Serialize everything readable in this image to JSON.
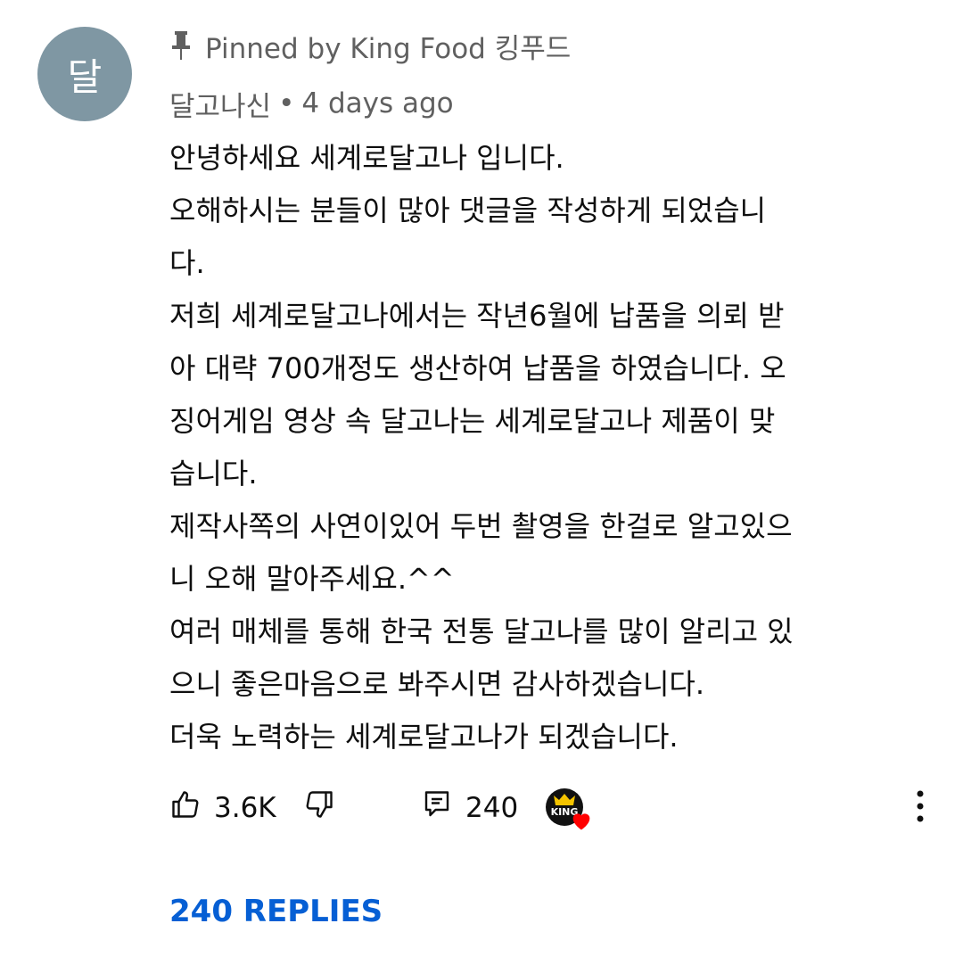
{
  "comment": {
    "avatar_letter": "달",
    "avatar_color": "#7f97a3",
    "pinned_text": "Pinned by King Food 킹푸드",
    "author": "달고나신",
    "separator": "•",
    "time_ago": "4 days ago",
    "body_lines": [
      "안녕하세요 세계로달고나 입니다.",
      "오해하시는 분들이 많아 댓글을 작성하게 되었습니",
      "다.",
      "저희 세계로달고나에서는 작년6월에 납품을 의뢰 받",
      "아 대략 700개정도 생산하여 납품을 하였습니다. 오",
      "징어게임 영상 속 달고나는 세계로달고나 제품이 맞",
      "습니다.",
      "제작사쪽의 사연이있어 두번 촬영을 한걸로 알고있으",
      "니 오해 말아주세요.^^",
      "여러 매체를 통해  한국 전통 달고나를 많이 알리고 있",
      "으니 좋은마음으로 봐주시면 감사하겠습니다.",
      "더욱 노력하는 세계로달고나가 되겠습니다."
    ]
  },
  "actions": {
    "like_count": "3.6K",
    "reply_count": "240",
    "creator_badge_text": "KING",
    "heart_color": "#ff0000"
  },
  "replies_label": "240 REPLIES",
  "colors": {
    "link_blue": "#065fd4",
    "secondary_text": "#606060",
    "primary_text": "#0f0f0f"
  }
}
